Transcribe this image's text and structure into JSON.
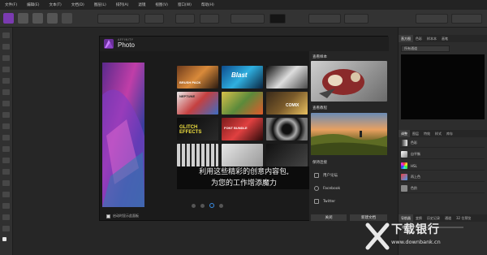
{
  "menu": {
    "items": [
      "文件(F)",
      "编辑(E)",
      "文本(T)",
      "文档(D)",
      "图层(L)",
      "排列(A)",
      "滤镜",
      "视图(V)",
      "窗口(W)",
      "帮助(H)"
    ],
    "right_items": [
      "Pixel",
      "Personas"
    ]
  },
  "dialog": {
    "brand_small": "AFFINITY",
    "brand": "Photo",
    "headline_line1": "利用这些精彩的创意内容包,",
    "headline_line2": "为您的工作增添魔力",
    "tiles": [
      "BRUSH PACK",
      "Blast",
      "",
      "NEPTUNE",
      "",
      "COMIX",
      "GLITCH EFFECTS",
      "FONT BUNDLE",
      "",
      "",
      "",
      ""
    ],
    "checkbox_label": "启动时显示此面板",
    "sidebar": {
      "section_samples": "查看样本",
      "section_tutorials": "查看教程",
      "section_connect": "保持连接",
      "links": [
        "用户论坛",
        "Facebook",
        "Twitter"
      ],
      "close_label": "关闭",
      "new_doc_label": "新建文档"
    }
  },
  "right_panel": {
    "top_tabs": [
      "直方图",
      "色彩",
      "样本本",
      "画笔"
    ],
    "dropdown_value": "所有通道",
    "mid_tabs": [
      "调整",
      "图层",
      "特效",
      "样式",
      "库存"
    ],
    "layers": [
      "色彩",
      "自平衡",
      "HSL",
      "再上色",
      "色阶"
    ],
    "bottom_tabs": [
      "导航器",
      "变换",
      "历史记录",
      "通道",
      "32 位预览"
    ],
    "zoom_label": "缩放"
  },
  "watermark": {
    "title": "下载银行",
    "url": "www.downbank.cn"
  },
  "colors": {
    "accent_blue": "#3a8ee6",
    "brand_purple": "#6a2f9a"
  }
}
